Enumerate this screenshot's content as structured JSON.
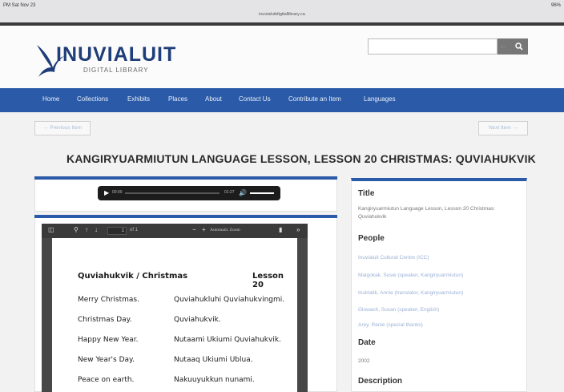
{
  "status_bar": {
    "time": "PM  Sat Nov 23",
    "url": "inuvialuitdigitallibrary.ca",
    "battery": "96%"
  },
  "header": {
    "logo_name": "INUVIALUIT",
    "logo_sub": "DIGITAL LIBRARY",
    "search_placeholder": "",
    "search_button_dots": "...",
    "search_icon": "search-icon"
  },
  "nav": {
    "items": [
      "Home",
      "Collections",
      "Exhibits",
      "Places",
      "About",
      "Contact Us",
      "Contribute an Item",
      "Languages"
    ]
  },
  "pager": {
    "prev": "← Previous Item",
    "next": "Next Item →"
  },
  "page_title": "KANGIRYUARMIUTUN LANGUAGE LESSON, LESSON 20 CHRISTMAS: QUVIAHUKVIK",
  "audio": {
    "current": "00:00",
    "duration": "01:27",
    "progress": 0.0,
    "volume": 1.0
  },
  "pdf": {
    "toolbar": {
      "page": "1",
      "of": "of 1",
      "zoom": "Automatic Zoom"
    },
    "header_left": "Quviahukvik / Christmas",
    "header_right": "Lesson 20",
    "rows": [
      {
        "en": "Merry Christmas.",
        "iu": "Quviahukluhi Quviahukvingmi."
      },
      {
        "en": "Christmas Day.",
        "iu": "Quviahukvik."
      },
      {
        "en": "Happy New Year.",
        "iu": "Nutaami Ukiumi Quviahukvik."
      },
      {
        "en": "New Year's Day.",
        "iu": "Nutaaq Ukiumi Ublua."
      },
      {
        "en": "Peace on earth.",
        "iu": "Nakuuyukkun nunami."
      }
    ]
  },
  "sidebar": {
    "title_heading": "Title",
    "title_value": "Kangiryuarmiutun Language Lesson, Lesson 20 Christmas: Quviahukvik",
    "people_heading": "People",
    "people": [
      "Inuvialuit Cultural Centre (ICC)",
      "Maigokak, Susie (speaker, Kangiryuarmiutun)",
      "Inuktalik, Annie (translator, Kangiryuarmiutun)",
      "Glowach, Susan (speaker, English)",
      "Arey, Renie (special thanks)"
    ],
    "date_heading": "Date",
    "date_value": "2002",
    "description_heading": "Description"
  },
  "colors": {
    "nav_blue": "#2b5ba8",
    "logo_blue": "#1f3d78",
    "link": "#9bb2d6"
  }
}
